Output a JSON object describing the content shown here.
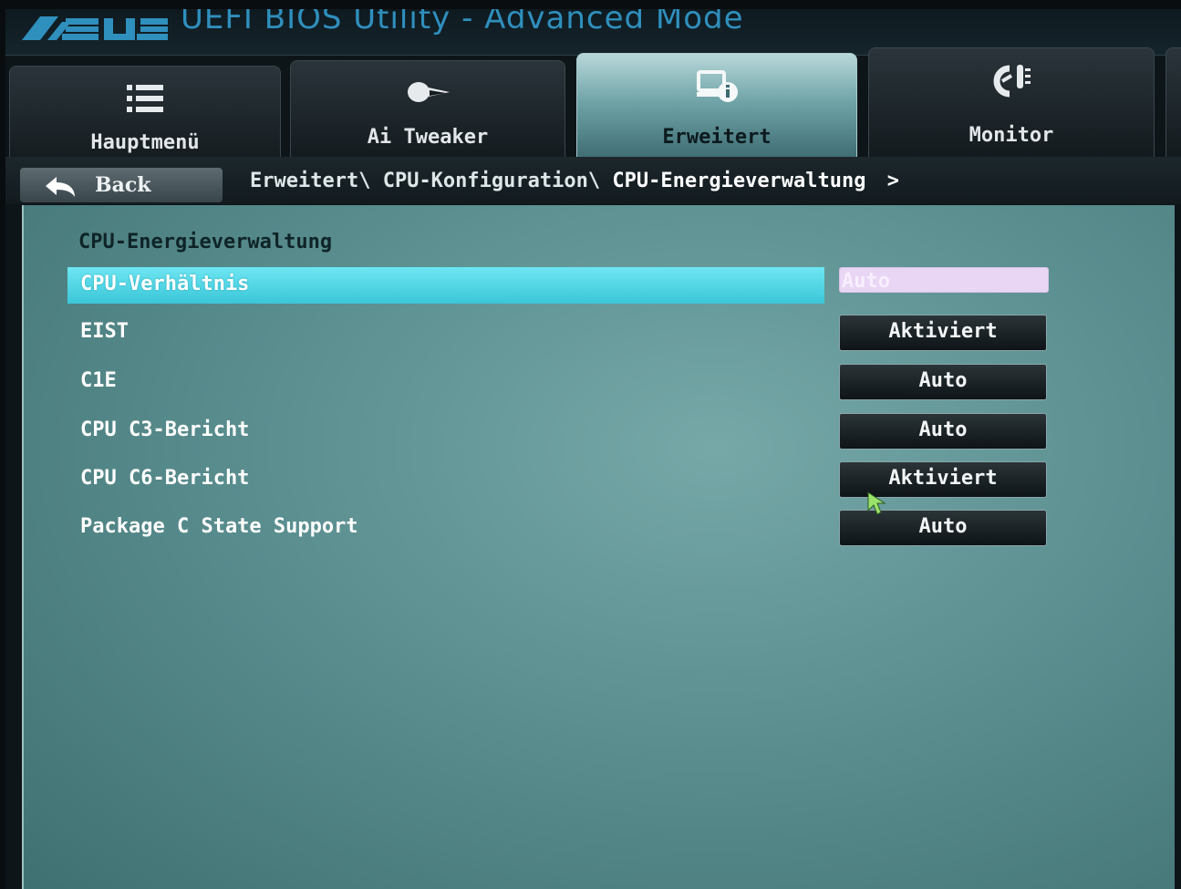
{
  "header": {
    "brand": "ASUS",
    "title": "UEFI BIOS Utility - Advanced Mode"
  },
  "tabs": [
    {
      "label": "Hauptmenü",
      "icon": "list-icon",
      "active": false
    },
    {
      "label": "Ai Tweaker",
      "icon": "comet-icon",
      "active": false
    },
    {
      "label": "Erweitert",
      "icon": "advanced-info-icon",
      "active": true
    },
    {
      "label": "Monitor",
      "icon": "thermometer-icon",
      "active": false
    }
  ],
  "nav": {
    "back_label": "Back",
    "breadcrumb": [
      "Erweitert\\",
      "CPU-Konfiguration\\",
      "CPU-Energieverwaltung"
    ],
    "breadcrumb_chevron": ">"
  },
  "section": {
    "title": "CPU-Energieverwaltung"
  },
  "settings": [
    {
      "label": "CPU-Verhältnis",
      "value": "Auto",
      "selected": true
    },
    {
      "label": "EIST",
      "value": "Aktiviert"
    },
    {
      "label": "C1E",
      "value": "Auto"
    },
    {
      "label": "CPU C3-Bericht",
      "value": "Auto"
    },
    {
      "label": "CPU C6-Bericht",
      "value": "Aktiviert"
    },
    {
      "label": "Package C State Support",
      "value": "Auto"
    }
  ],
  "colors": {
    "highlight": "#4fd3e3",
    "panel": "#5f9293",
    "title_blue": "#2f8fbd"
  }
}
